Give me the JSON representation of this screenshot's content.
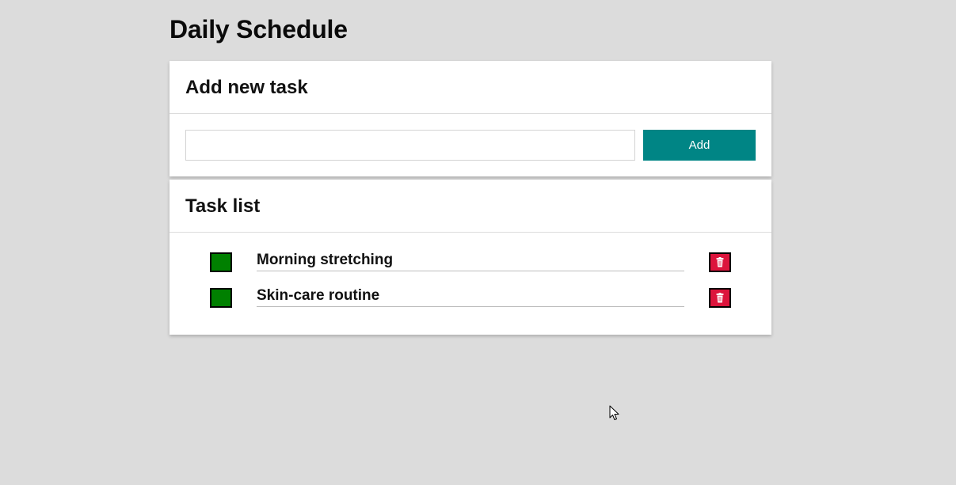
{
  "page": {
    "title": "Daily Schedule"
  },
  "add_task": {
    "heading": "Add new task",
    "input_value": "",
    "input_placeholder": "",
    "button_label": "Add"
  },
  "task_list": {
    "heading": "Task list",
    "items": [
      {
        "text": "Morning stretching",
        "check_icon": "green-square",
        "delete_icon": "trash-icon"
      },
      {
        "text": "Skin-care routine",
        "check_icon": "green-square",
        "delete_icon": "trash-icon"
      }
    ]
  },
  "colors": {
    "background": "#dcdcdc",
    "accent": "#008585",
    "check": "#008000",
    "delete": "#dc143c"
  }
}
